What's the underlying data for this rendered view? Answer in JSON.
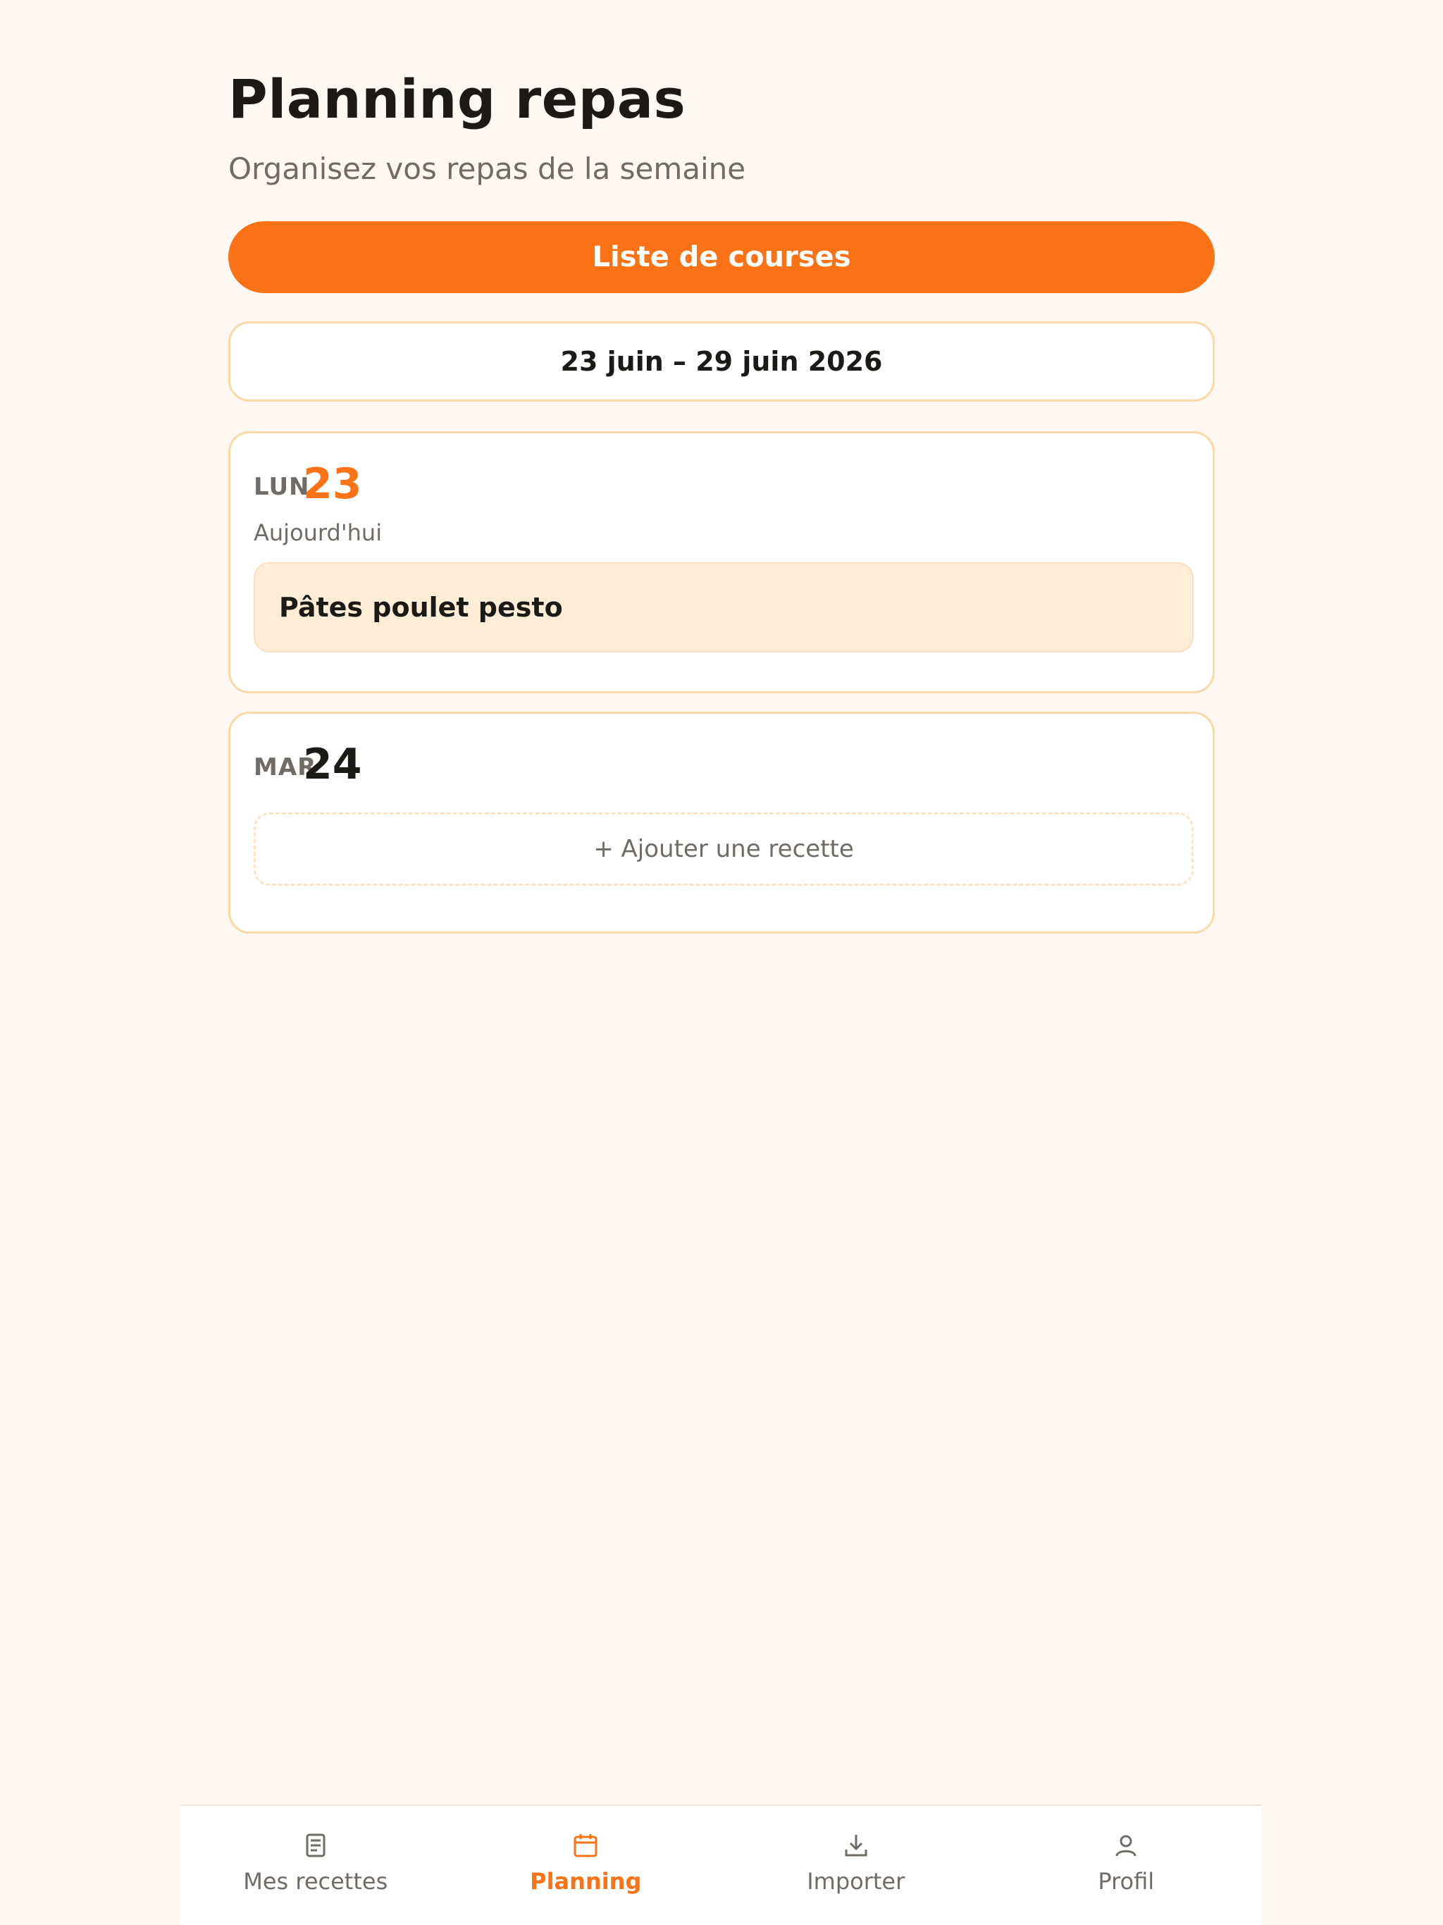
{
  "header": {
    "title": "Planning repas",
    "subtitle": "Organisez vos repas de la semaine"
  },
  "actions": {
    "shopping_list_label": "Liste de courses"
  },
  "week": {
    "range_label": "23 juin – 29 juin 2026"
  },
  "days": [
    {
      "abbr": "LUN",
      "number": "23",
      "note": "Aujourd'hui",
      "is_today": true,
      "meals": [
        "Pâtes poulet pesto"
      ]
    },
    {
      "abbr": "MAR",
      "number": "24",
      "is_today": false,
      "add_label": "+ Ajouter une recette"
    }
  ],
  "bottom_nav": {
    "items": [
      {
        "label": "Mes recettes",
        "icon": "recipes-icon",
        "active": false
      },
      {
        "label": "Planning",
        "icon": "calendar-icon",
        "active": true
      },
      {
        "label": "Importer",
        "icon": "import-icon",
        "active": false
      },
      {
        "label": "Profil",
        "icon": "profile-icon",
        "active": false
      }
    ]
  },
  "colors": {
    "accent": "#f97316",
    "background": "#fff7f1",
    "card_border": "#fbd9a8",
    "meal_chip": "#ffedd5",
    "muted_text": "#716b65"
  }
}
